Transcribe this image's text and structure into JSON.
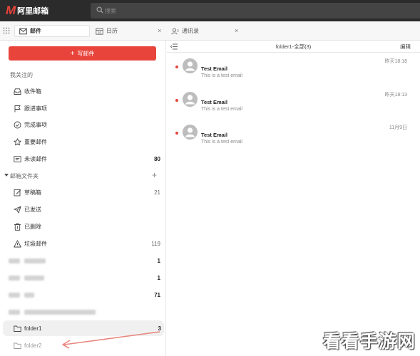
{
  "app": {
    "logo_mark": "M",
    "logo_text": "阿里邮箱"
  },
  "search": {
    "placeholder": "搜索",
    "icon": "search-icon"
  },
  "tabs": [
    {
      "label": "邮件",
      "icon": "mail-icon",
      "active": true
    },
    {
      "label": "日历",
      "icon": "calendar-icon",
      "close": "×"
    },
    {
      "label": "通讯录",
      "icon": "contacts-icon",
      "close": "×"
    }
  ],
  "compose": {
    "plus": "+",
    "label": "写邮件"
  },
  "sidebar": {
    "focus_label": "我关注的",
    "focus_items": [
      {
        "label": "收件箱",
        "icon": "inbox-icon",
        "count": ""
      },
      {
        "label": "跟进事项",
        "icon": "flag-icon",
        "count": ""
      },
      {
        "label": "完成事项",
        "icon": "check-circle-icon",
        "count": ""
      },
      {
        "label": "重要邮件",
        "icon": "star-icon",
        "count": ""
      },
      {
        "label": "未读邮件",
        "icon": "unread-mail-icon",
        "count": "80"
      }
    ],
    "folders_label": "邮箱文件夹",
    "folders_add": "+",
    "folder_items": [
      {
        "label": "草稿箱",
        "icon": "draft-icon",
        "count": "21"
      },
      {
        "label": "已发送",
        "icon": "send-icon",
        "count": ""
      },
      {
        "label": "已删除",
        "icon": "trash-icon",
        "count": ""
      },
      {
        "label": "垃圾邮件",
        "icon": "warning-icon",
        "count": "119"
      }
    ],
    "blurred_counts": [
      "1",
      "1",
      "71"
    ],
    "custom_folders": [
      {
        "label": "folder1",
        "icon": "folder-icon",
        "count": "3",
        "selected": true
      },
      {
        "label": "folder2",
        "icon": "folder-icon",
        "count": ""
      }
    ]
  },
  "main": {
    "title": "folder1-全部(3)",
    "edit_label": "编辑",
    "messages": [
      {
        "sender": "Test Email",
        "preview": "This is a test email",
        "time": "昨天18:18",
        "unread": true
      },
      {
        "sender": "Test Email",
        "preview": "This is a test email",
        "time": "昨天18:13",
        "unread": true
      },
      {
        "sender": "Test Email",
        "preview": "This is a test email",
        "time": "11月9日",
        "unread": true
      }
    ]
  },
  "watermark": "看看手游网",
  "colors": {
    "accent": "#e8443b",
    "topbar": "#2b2b2b",
    "arrow": "#e8877e"
  }
}
